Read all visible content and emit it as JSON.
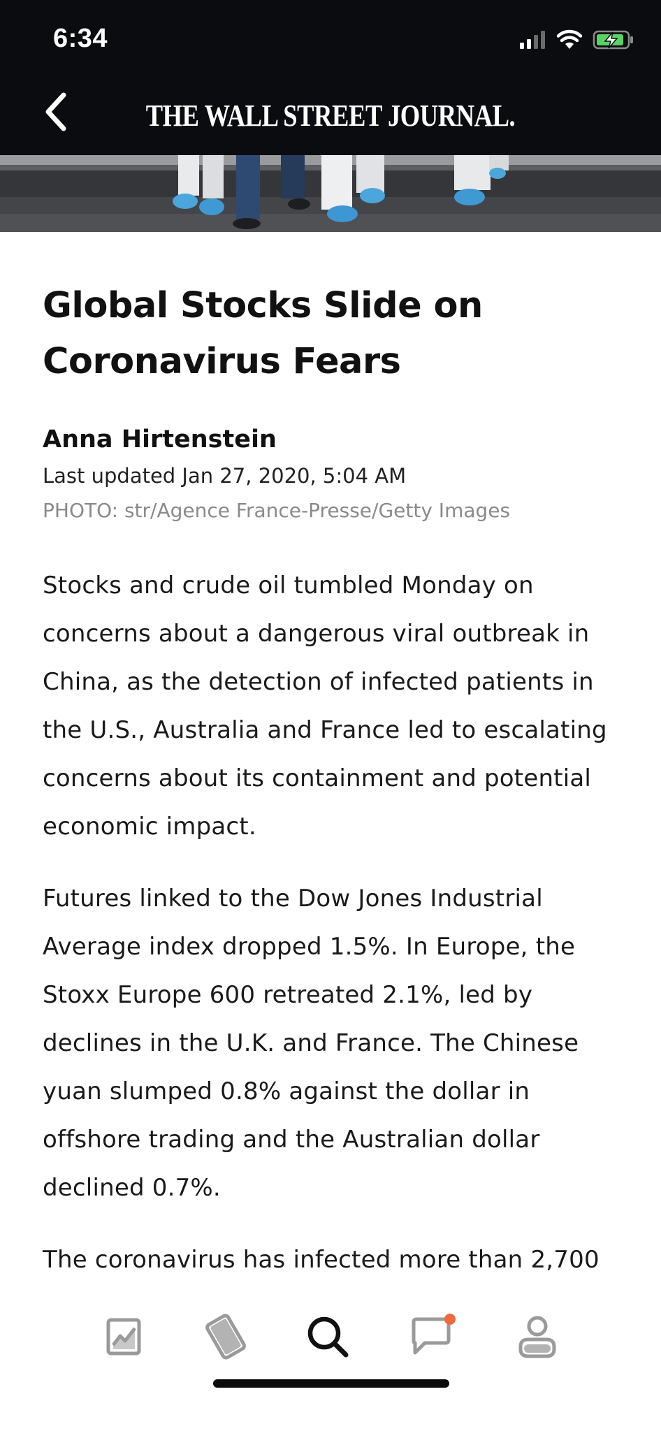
{
  "status_bar": {
    "time": "6:34",
    "icons": [
      "cellular-signal-icon",
      "wifi-icon",
      "battery-charging-icon"
    ]
  },
  "nav": {
    "back_icon": "chevron-left-icon",
    "masthead": "THE WALL STREET JOURNAL."
  },
  "article": {
    "headline": "Global Stocks Slide on Coronavirus Fears",
    "author": "Anna Hirtenstein",
    "last_updated": "Last updated Jan 27, 2020, 5:04 AM",
    "photo_credit": "PHOTO: str/Agence France-Presse/Getty Images",
    "paragraphs": [
      "Stocks and crude oil tumbled Monday on concerns about a dangerous viral outbreak in China, as the detection of infected patients in the U.S., Australia and France led to escalating concerns about its containment and potential economic impact.",
      "Futures linked to the Dow Jones Industrial Average index dropped 1.5%. In Europe, the Stoxx Europe 600 retreated 2.1%, led by declines in the U.K. and France. The Chinese yuan slumped 0.8% against the dollar in offshore trading and the Australian dollar declined 0.7%.",
      "The coronavirus has infected more than 2,700"
    ]
  },
  "tab_bar": {
    "tabs": [
      {
        "icon": "markets-chart-icon",
        "active": false
      },
      {
        "icon": "saved-tag-icon",
        "active": false
      },
      {
        "icon": "search-icon",
        "active": true
      },
      {
        "icon": "messages-icon",
        "active": false,
        "badge": true
      },
      {
        "icon": "profile-icon",
        "active": false
      }
    ],
    "badge_color": "#ee6a3c",
    "active_color": "#111111",
    "inactive_color": "#9a9a9a"
  }
}
